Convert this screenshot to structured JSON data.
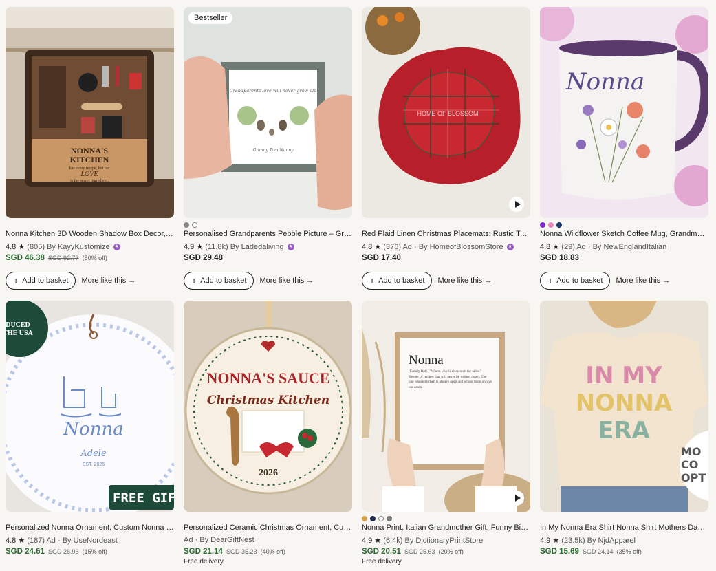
{
  "products": [
    {
      "title": "Nonna Kitchen 3D Wooden Shadow Box Decor, Italian Grandma Gift",
      "rating": "4.8",
      "reviews": "(805)",
      "ad": "",
      "seller": "By KayyKustomize",
      "star_seller": true,
      "price": "SGD 46.38",
      "old_price": "SGD 92.77",
      "discount": "(50% off)",
      "free": "",
      "badge": ""
    },
    {
      "title": "Personalised Grandparents Pebble Picture – Grandparents Gift",
      "rating": "4.9",
      "reviews": "(11.8k)",
      "ad": "",
      "seller": "By Ladedaliving",
      "star_seller": true,
      "price": "SGD 29.48",
      "old_price": "",
      "discount": "",
      "free": "",
      "badge": "Bestseller"
    },
    {
      "title": "Red Plaid Linen Christmas Placemats: Rustic Tartan Table Decor",
      "rating": "4.8",
      "reviews": "(376)",
      "ad": "Ad",
      "seller": "By HomeofBlossomStore",
      "star_seller": true,
      "price": "SGD 17.40",
      "old_price": "",
      "discount": "",
      "free": "",
      "badge": ""
    },
    {
      "title": "Nonna Wildflower Sketch Coffee Mug, Grandmother Gift Cup",
      "rating": "4.8",
      "reviews": "(29)",
      "ad": "Ad",
      "seller": "By NewEnglandItalian",
      "star_seller": false,
      "price": "SGD 18.83",
      "old_price": "",
      "discount": "",
      "free": "",
      "badge": ""
    },
    {
      "title": "Personalized Nonna Ornament, Custom Nonna Christmas Ornament",
      "rating": "4.8",
      "reviews": "(187)",
      "ad": "Ad",
      "seller": "By UseNordeast",
      "star_seller": false,
      "price": "SGD 24.61",
      "old_price": "SGD 28.96",
      "discount": "(15% off)",
      "free": "",
      "badge": ""
    },
    {
      "title": "Personalized Ceramic Christmas Ornament, Custom Nonna's Sauce",
      "rating": "",
      "reviews": "",
      "ad": "Ad",
      "seller": "By DearGiftNest",
      "star_seller": false,
      "price": "SGD 21.14",
      "old_price": "SGD 35.23",
      "discount": "(40% off)",
      "free": "Free delivery",
      "badge": ""
    },
    {
      "title": "Nonna Print, Italian Grandmother Gift, Funny Birthday Poster",
      "rating": "4.9",
      "reviews": "(6.4k)",
      "ad": "",
      "seller": "By DictionaryPrintStore",
      "star_seller": false,
      "price": "SGD 20.51",
      "old_price": "SGD 25.63",
      "discount": "(20% off)",
      "free": "Free delivery",
      "badge": ""
    },
    {
      "title": "In My Nonna Era Shirt Nonna Shirt Mothers Day Gift for Grandma",
      "rating": "4.9",
      "reviews": "(23.5k)",
      "ad": "",
      "seller": "By NjdApparel",
      "star_seller": false,
      "price": "SGD 15.69",
      "old_price": "SGD 24.14",
      "discount": "(35% off)",
      "free": "",
      "badge": ""
    }
  ],
  "buttons": {
    "add": "Add to basket",
    "more": "More like this"
  },
  "art": {
    "p1_line1": "NONNA'S",
    "p1_line2": "KITCHEN",
    "p1_line3": "has every recipe, but her",
    "p1_line4": "LOVE",
    "p1_line5": "is the secret ingredient.",
    "p2_text": "Grandparents love will never grow old",
    "p2_names": "Granny  Tom  Nanny",
    "p3_watermark": "HOME OF BLOSSOM",
    "p4_mug": "Nonna",
    "p5_badge1": "DUCED",
    "p5_badge2": "THE USA",
    "p5_name": "Nonna",
    "p5_sub": "Adele",
    "p5_year": "EST. 2026",
    "p5_gift": "FREE GIFT",
    "p6_l1": "NONNA'S SAUCE",
    "p6_l2": "Christmas Kitchen",
    "p6_year": "2026",
    "p7_title": "Nonna",
    "p7_def": "[Family Role] \"Where love is always on the table.\" Keeper of recipes that will never be written down. The one whose kitchen is always open and whose table always has room.",
    "p8_l1": "IN MY",
    "p8_l2": "NONNA",
    "p8_l3": "ERA",
    "p8_side": "MO CO OPT"
  }
}
